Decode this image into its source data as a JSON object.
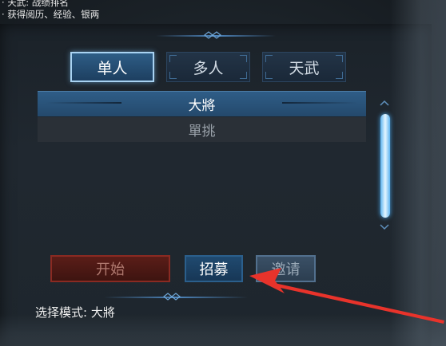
{
  "info": {
    "line1": "· 天武: 战绩排名",
    "line2": "· 获得阅历、经验、银两"
  },
  "tabs": [
    {
      "label": "单人",
      "active": true
    },
    {
      "label": "多人",
      "active": false
    },
    {
      "label": "天武",
      "active": false
    }
  ],
  "modes": [
    {
      "label": "大將",
      "selected": true
    },
    {
      "label": "單挑",
      "selected": false
    }
  ],
  "buttons": {
    "start": "开始",
    "recruit": "招募",
    "invite": "邀请"
  },
  "status": {
    "mode_text": "选择模式: 大將"
  },
  "colors": {
    "accent": "#4e87c0",
    "annotation_arrow": "#e8332b"
  }
}
